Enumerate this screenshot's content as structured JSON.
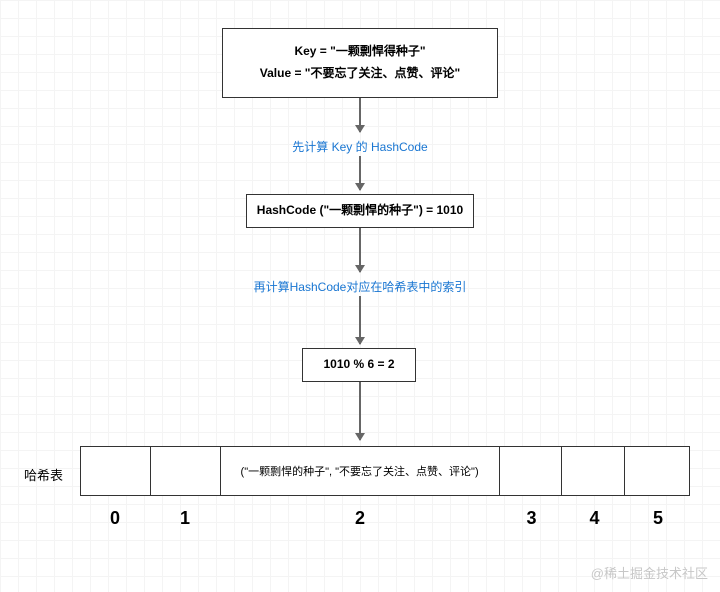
{
  "box1": {
    "line1": "Key =  \"一颗剽悍得种子\"",
    "line2": "Value =  \"不要忘了关注、点赞、评论\""
  },
  "note1": "先计算 Key 的 HashCode",
  "box2": "HashCode (\"一颗剽悍的种子\")  = 1010",
  "note2": "再计算HashCode对应在哈希表中的索引",
  "box3": "1010 % 6 = 2",
  "tableLabel": "哈希表",
  "cells": {
    "c0": "",
    "c1": "",
    "c2": "(\"一颗剽悍的种子\", \"不要忘了关注、点赞、评论\")",
    "c3": "",
    "c4": "",
    "c5": ""
  },
  "indices": [
    "0",
    "1",
    "2",
    "3",
    "4",
    "5"
  ],
  "watermark": "@稀土掘金技术社区",
  "chart_data": {
    "type": "table",
    "title": "HashMap insertion flow",
    "steps": [
      "Key = \"一颗剽悍得种子\"",
      "Value = \"不要忘了关注、点赞、评论\"",
      "先计算 Key 的 HashCode",
      "HashCode(\"一颗剽悍的种子\") = 1010",
      "再计算HashCode对应在哈希表中的索引",
      "1010 % 6 = 2"
    ],
    "hash_table": {
      "size": 6,
      "indices": [
        0,
        1,
        2,
        3,
        4,
        5
      ],
      "buckets": [
        null,
        null,
        {
          "key": "一颗剽悍的种子",
          "value": "不要忘了关注、点赞、评论"
        },
        null,
        null,
        null
      ]
    }
  }
}
